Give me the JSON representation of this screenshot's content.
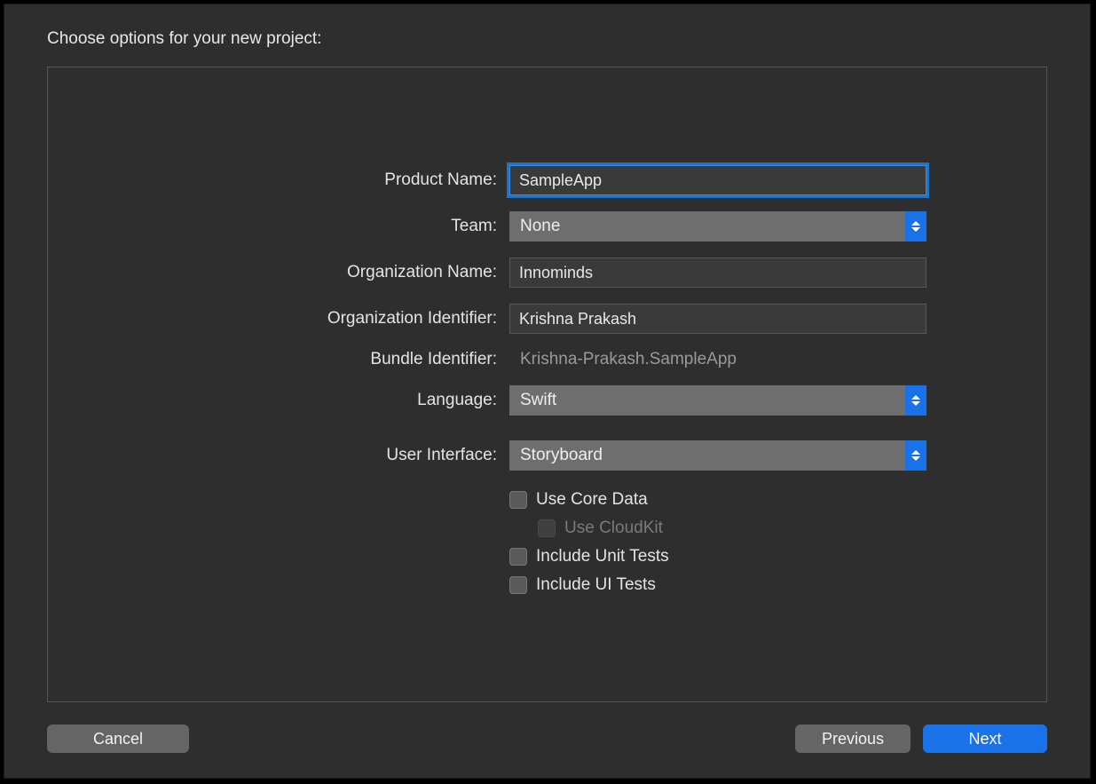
{
  "header": {
    "title": "Choose options for your new project:"
  },
  "form": {
    "productName": {
      "label": "Product Name:",
      "value": "SampleApp"
    },
    "team": {
      "label": "Team:",
      "value": "None"
    },
    "orgName": {
      "label": "Organization Name:",
      "value": "Innominds"
    },
    "orgIdentifier": {
      "label": "Organization Identifier:",
      "value": "Krishna Prakash"
    },
    "bundleIdentifier": {
      "label": "Bundle Identifier:",
      "value": "Krishna-Prakash.SampleApp"
    },
    "language": {
      "label": "Language:",
      "value": "Swift"
    },
    "userInterface": {
      "label": "User Interface:",
      "value": "Storyboard"
    },
    "useCoreData": {
      "label": "Use Core Data",
      "checked": false
    },
    "useCloudKit": {
      "label": "Use CloudKit",
      "checked": false,
      "disabled": true
    },
    "includeUnitTests": {
      "label": "Include Unit Tests",
      "checked": false
    },
    "includeUITests": {
      "label": "Include UI Tests",
      "checked": false
    }
  },
  "buttons": {
    "cancel": "Cancel",
    "previous": "Previous",
    "next": "Next"
  }
}
